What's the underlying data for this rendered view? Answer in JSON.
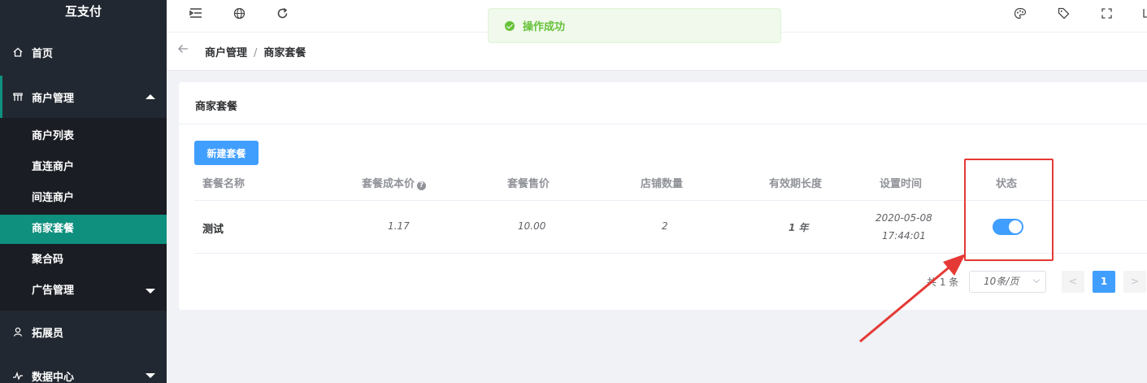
{
  "app": {
    "title": "互支付"
  },
  "sidebar": {
    "items": [
      {
        "label": "首页",
        "icon": "home-icon"
      },
      {
        "label": "商户管理",
        "icon": "shop-icon",
        "expanded": true
      },
      {
        "label": "拓展员",
        "icon": "user-icon"
      },
      {
        "label": "数据中心",
        "icon": "chart-icon"
      }
    ],
    "submenu": [
      {
        "label": "商户列表"
      },
      {
        "label": "直连商户"
      },
      {
        "label": "间连商户"
      },
      {
        "label": "商家套餐",
        "active": true
      },
      {
        "label": "聚合码"
      },
      {
        "label": "广告管理",
        "has_children": true
      }
    ]
  },
  "toast": {
    "message": "操作成功",
    "type": "success"
  },
  "breadcrumb": {
    "parent": "商户管理",
    "separator": "/",
    "current": "商家套餐"
  },
  "card": {
    "title": "商家套餐",
    "new_button": "新建套餐"
  },
  "table": {
    "columns": [
      "套餐名称",
      "套餐成本价",
      "套餐售价",
      "店铺数量",
      "有效期长度",
      "设置时间",
      "状态"
    ],
    "rows": [
      {
        "name": "测试",
        "cost": "1.17",
        "price": "10.00",
        "stores": "2",
        "duration": "1 年",
        "date": "2020-05-08",
        "time": "17:44:01",
        "status_on": true
      }
    ]
  },
  "pagination": {
    "total_text": "共 1 条",
    "page_size": "10条/页",
    "current_page": "1",
    "prev": "<",
    "next": ">"
  },
  "colors": {
    "sidebar_bg": "#222831",
    "sidebar_active": "#0f8f7e",
    "primary": "#409eff",
    "success": "#67c23a",
    "annotation": "#e53935"
  }
}
